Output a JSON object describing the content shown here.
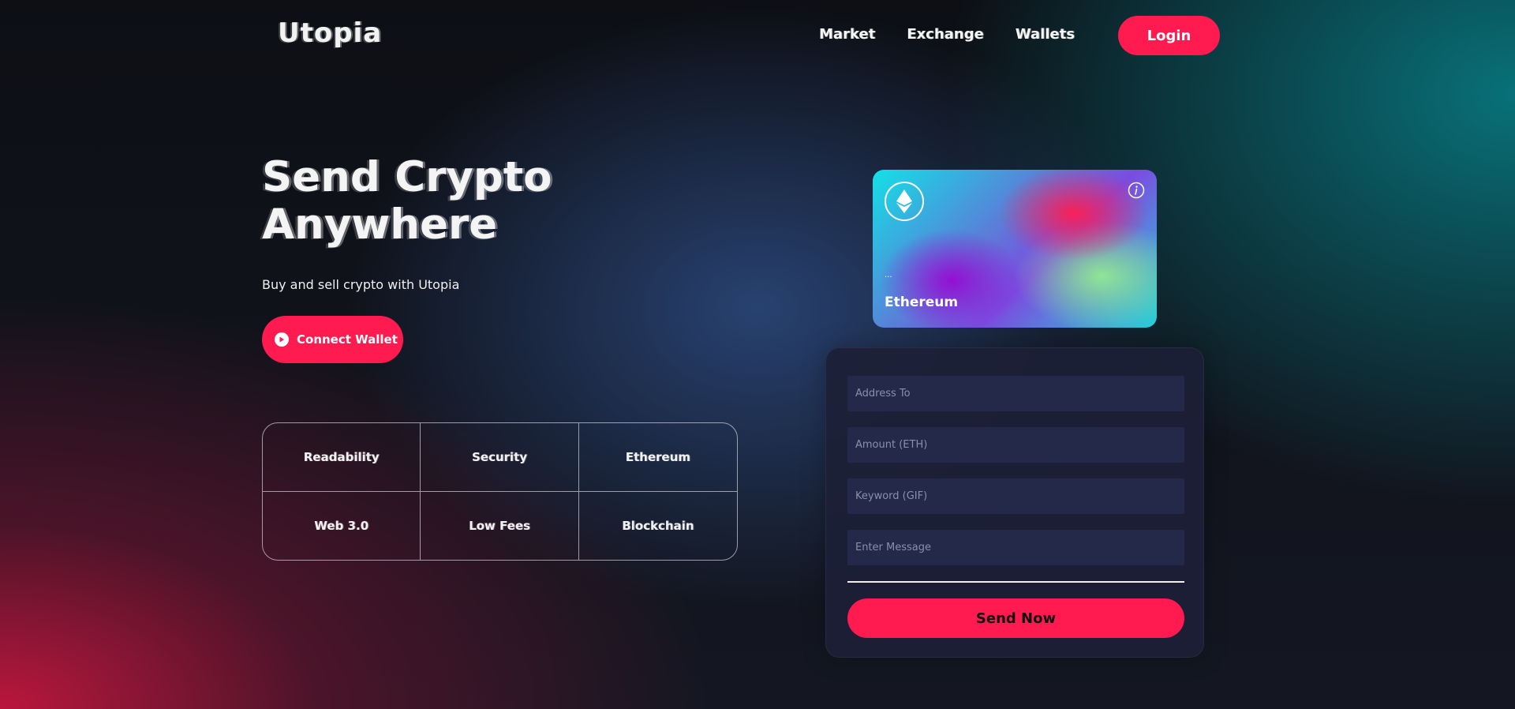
{
  "header": {
    "logo": "Utopia",
    "nav": [
      "Market",
      "Exchange",
      "Wallets"
    ],
    "login_label": "Login"
  },
  "hero": {
    "title_line1": "Send Crypto",
    "title_line2": "Anywhere",
    "subtitle": "Buy and sell crypto with Utopia",
    "connect_label": "Connect Wallet"
  },
  "features": [
    "Readability",
    "Security",
    "Ethereum",
    "Web 3.0",
    "Low Fees",
    "Blockchain"
  ],
  "card": {
    "address": "...",
    "name": "Ethereum"
  },
  "form": {
    "address_placeholder": "Address To",
    "amount_placeholder": "Amount (ETH)",
    "keyword_placeholder": "Keyword (GIF)",
    "message_placeholder": "Enter Message",
    "send_label": "Send Now"
  },
  "colors": {
    "accent": "#ff1a4f",
    "panel": "#1c2036",
    "input": "#24294a"
  }
}
